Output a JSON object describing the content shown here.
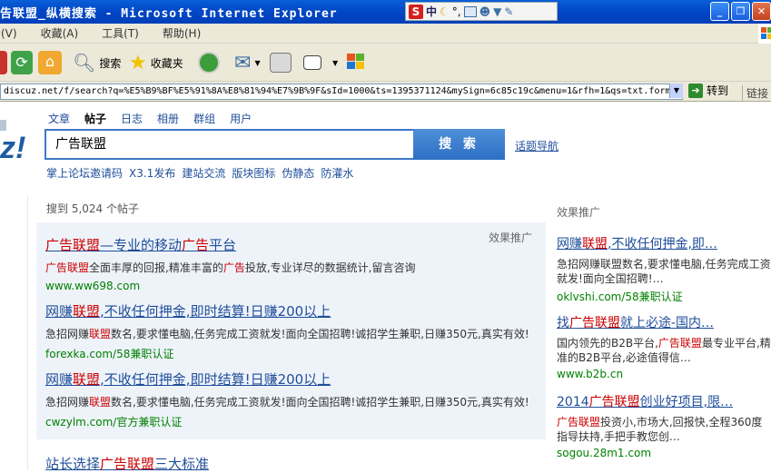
{
  "window": {
    "title": "告联盟_纵横搜索 - Microsoft Internet Explorer",
    "ime_logo": "S",
    "ime_mode": "中",
    "ime_punct": "°,"
  },
  "menu": [
    "查看(V)",
    "收藏(A)",
    "工具(T)",
    "帮助(H)"
  ],
  "toolbar": {
    "search_label": "搜索",
    "favorites_label": "收藏夹"
  },
  "address": {
    "url": "discuz.net/f/search?q=%E5%B9%BF%E5%91%8A%E8%81%94%E7%9B%9F&sId=1000&ts=1395371124&mySign=6c85c19c&menu=1&rfh=1&qs=txt.form",
    "go_label": "转到",
    "links_label": "链接"
  },
  "site": {
    "logo": "z!"
  },
  "search": {
    "tabs": [
      "文章",
      "帖子",
      "日志",
      "相册",
      "群组",
      "用户"
    ],
    "active_tab": "帖子",
    "query": "广告联盟",
    "button": "搜 索",
    "topic_nav": "话题导航",
    "quick_links": [
      "掌上论坛邀请码",
      "X3.1发布",
      "建站交流",
      "版块图标",
      "伪静态",
      "防灌水"
    ],
    "count_text": "搜到 5,024 个帖子"
  },
  "ads": {
    "label": "效果推广",
    "items": [
      {
        "title_hl": "广告联盟",
        "title_rest": "—专业的移动",
        "title_hl2": "广告",
        "title_rest2": "平台",
        "desc_hl": "广告联盟",
        "desc": "全面丰厚的回报,精准丰富的",
        "desc_hl2": "广告",
        "desc2": "投放,专业详尽的数据统计,留言咨询",
        "url": "www.ww698.com"
      },
      {
        "title_a": "网赚",
        "title_hl": "联盟",
        "title_b": ",不收任何押金,即时结算!日赚200以上",
        "desc_a": "急招网赚",
        "desc_hl": "联盟",
        "desc_b": "数名,要求懂电脑,任务完成工资就发!面向全国招聘!诚招学生兼职,日赚350元,真实有效!",
        "url": "forexka.com/58兼职认证"
      },
      {
        "title_a": "网赚",
        "title_hl": "联盟",
        "title_b": ",不收任何押金,即时结算!日赚200以上",
        "desc_a": "急招网赚",
        "desc_hl": "联盟",
        "desc_b": "数名,要求懂电脑,任务完成工资就发!面向全国招聘!诚招学生兼职,日赚350元,真实有效!",
        "url": "cwzylm.com/官方兼职认证"
      }
    ]
  },
  "next_result": {
    "a": "站长选择",
    "hl": "广告联盟",
    "b": "三大标准"
  },
  "sidebar": {
    "label": "效果推广",
    "items": [
      {
        "title_a": "网赚",
        "title_hl": "联盟",
        "title_b": ",不收任何押金,即…",
        "desc": "急招网赚联盟数名,要求懂电脑,任务完成工资就发!面向全国招聘!…",
        "url": "oklvshi.com/58兼职认证"
      },
      {
        "title_a": "找",
        "title_hl": "广告联盟",
        "title_b": "就上必途-国内…",
        "desc_a": "国内领先的B2B平台,",
        "desc_hl": "广告联盟",
        "desc_b": "最专业平台,精准的B2B平台,必途值得信…",
        "url": "www.b2b.cn"
      },
      {
        "title_a": "2014",
        "title_hl": "广告联盟",
        "title_b": "创业好项目,限…",
        "desc_hl": "广告联盟",
        "desc_b": "投资小,市场大,回报快,全程360度指导扶持,手把手教您创…",
        "url": "sogou.28m1.com"
      }
    ]
  }
}
